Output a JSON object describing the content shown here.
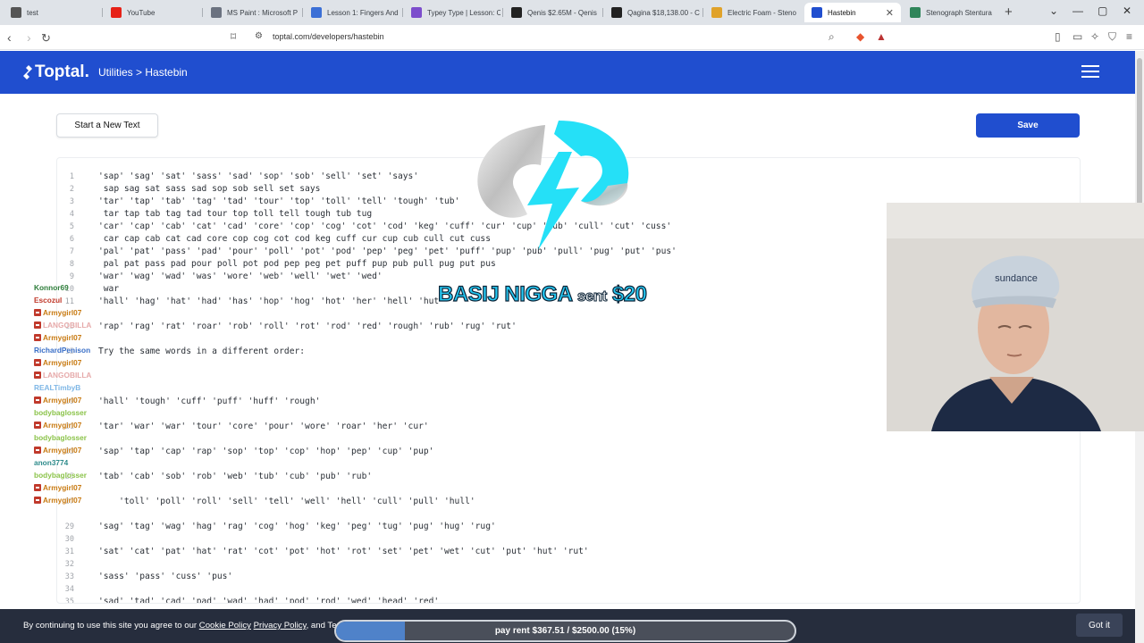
{
  "browser": {
    "tabs": [
      {
        "label": "test",
        "fav": "#555"
      },
      {
        "label": "YouTube",
        "fav": "#e62117"
      },
      {
        "label": "MS Paint : Microsoft P",
        "fav": "#6b7280"
      },
      {
        "label": "Lesson 1: Fingers And",
        "fav": "#3b6fd6"
      },
      {
        "label": "Typey Type | Lesson: C",
        "fav": "#7c4dcc"
      },
      {
        "label": "Qenis $2.65M - Qenis",
        "fav": "#222"
      },
      {
        "label": "Qagina $18,138.00 - C",
        "fav": "#222"
      },
      {
        "label": "Electric Foam - Steno",
        "fav": "#e0a22a"
      },
      {
        "label": "Hastebin",
        "fav": "#204ecf",
        "active": true
      },
      {
        "label": "Stenograph Stentura",
        "fav": "#2f855a"
      }
    ],
    "url": "toptal.com/developers/hastebin"
  },
  "header": {
    "logo": "Toptal.",
    "breadcrumb": "Utilities > Hastebin"
  },
  "actions": {
    "new_label": "Start a New Text",
    "save_label": "Save"
  },
  "editor": {
    "lines": [
      {
        "n": "1",
        "text": "'sap' 'sag' 'sat' 'sass' 'sad' 'sop' 'sob' 'sell' 'set' 'says'"
      },
      {
        "n": "2",
        "text": " sap sag sat sass sad sop sob sell set says"
      },
      {
        "n": "3",
        "text": "'tar' 'tap' 'tab' 'tag' 'tad' 'tour' 'top' 'toll' 'tell' 'tough' 'tub'"
      },
      {
        "n": "4",
        "text": " tar tap tab tag tad tour top toll tell tough tub tug"
      },
      {
        "n": "5",
        "text": "'car' 'cap' 'cab' 'cat' 'cad' 'core' 'cop' 'cog' 'cot' 'cod' 'keg' 'cuff' 'cur' 'cup' 'cub' 'cull' 'cut' 'cuss'"
      },
      {
        "n": "6",
        "text": " car cap cab cat cad core cop cog cot cod keg cuff cur cup cub cull cut cuss"
      },
      {
        "n": "7",
        "text": "'pal' 'pat' 'pass' 'pad' 'pour' 'poll' 'pot' 'pod' 'pep' 'peg' 'pet' 'puff' 'pup' 'pub' 'pull' 'pug' 'put' 'pus'"
      },
      {
        "n": "8",
        "text": " pal pat pass pad pour poll pot pod pep peg pet puff pup pub pull pug put pus"
      },
      {
        "n": "9",
        "text": "'war' 'wag' 'wad' 'was' 'wore' 'web' 'well' 'wet' 'wed'"
      },
      {
        "n": "10",
        "text": " war"
      },
      {
        "n": "11",
        "text": "'hall' 'hag' 'hat' 'had' 'has' 'hop' 'hog' 'hot' 'her' 'hell' 'hut'"
      },
      {
        "n": "13",
        "text": "'rap' 'rag' 'rat' 'roar' 'rob' 'roll' 'rot' 'rod' 'red' 'rough' 'rub' 'rug' 'rut'"
      },
      {
        "n": "15",
        "text": "Try the same words in a different order:"
      },
      {
        "n": "19",
        "text": "'hall' 'tough' 'cuff' 'puff' 'huff' 'rough'"
      },
      {
        "n": "21",
        "text": "'tar' 'war' 'war' 'tour' 'core' 'pour' 'wore' 'roar' 'her' 'cur'"
      },
      {
        "n": "23",
        "text": "'sap' 'tap' 'cap' 'rap' 'sop' 'top' 'cop' 'hop' 'pep' 'cup' 'pup'"
      },
      {
        "n": "25",
        "text": "'tab' 'cab' 'sob' 'rob' 'web' 'tub' 'cub' 'pub' 'rub'"
      },
      {
        "n": "27",
        "text": "    'toll' 'poll' 'roll' 'sell' 'tell' 'well' 'hell' 'cull' 'pull' 'hull'"
      },
      {
        "n": "29",
        "text": "'sag' 'tag' 'wag' 'hag' 'rag' 'cog' 'hog' 'keg' 'peg' 'tug' 'pug' 'hug' 'rug'"
      },
      {
        "n": "30",
        "text": ""
      },
      {
        "n": "31",
        "text": "'sat' 'cat' 'pat' 'hat' 'rat' 'cot' 'pot' 'hot' 'rot' 'set' 'pet' 'wet' 'cut' 'put' 'hut' 'rut'"
      },
      {
        "n": "32",
        "text": ""
      },
      {
        "n": "33",
        "text": "'sass' 'pass' 'cuss' 'pus'"
      },
      {
        "n": "34",
        "text": ""
      },
      {
        "n": "35",
        "text": "'sad' 'tad' 'cad' 'pad' 'wad' 'had' 'pod' 'rod' 'wed' 'head' 'red'"
      }
    ]
  },
  "chat": [
    {
      "name": "Konnor69",
      "color": "#2d7d3a"
    },
    {
      "name": "Escozul",
      "color": "#c0392b"
    },
    {
      "name": "Armygirl07",
      "color": "#c87a12"
    },
    {
      "name": "LANGOBILLA",
      "color": "#e6a9a9"
    },
    {
      "name": "Armygirl07",
      "color": "#c87a12"
    },
    {
      "name": "RichardPenison",
      "color": "#3a6fc7"
    },
    {
      "name": "Armygirl07",
      "color": "#c87a12"
    },
    {
      "name": "LANGOBILLA",
      "color": "#e6a9a9"
    },
    {
      "name": "REALTimbyB",
      "color": "#7fb7e6"
    },
    {
      "name": "Armygirl07",
      "color": "#c87a12"
    },
    {
      "name": "bodybaglosser",
      "color": "#8bc34a"
    },
    {
      "name": "Armygirl07",
      "color": "#c87a12"
    },
    {
      "name": "bodybaglosser",
      "color": "#8bc34a"
    },
    {
      "name": "Armygirl07",
      "color": "#c87a12"
    },
    {
      "name": "anon3774",
      "color": "#2e8b8b"
    },
    {
      "name": "bodybaglosser",
      "color": "#8bc34a"
    },
    {
      "name": "Armygirl07",
      "color": "#c87a12"
    },
    {
      "name": "Armygirl07",
      "color": "#c87a12"
    }
  ],
  "donation": {
    "name": "BASIJ NIGGA",
    "sent": "sent",
    "amount": "$20"
  },
  "webcam": {
    "cap_text": "sundance"
  },
  "cookie": {
    "prefix": "By continuing to use this site you agree to our",
    "cookie_policy": "Cookie Policy",
    "privacy_policy": "Privacy Policy",
    "suffix": ", and Terms of Use.",
    "button": "Got it"
  },
  "goal": {
    "text": "pay rent $367.51 / $2500.00 (15%)",
    "progress": 0.15
  },
  "colors": {
    "brand": "#204ecf",
    "accent": "#25c8f2"
  }
}
